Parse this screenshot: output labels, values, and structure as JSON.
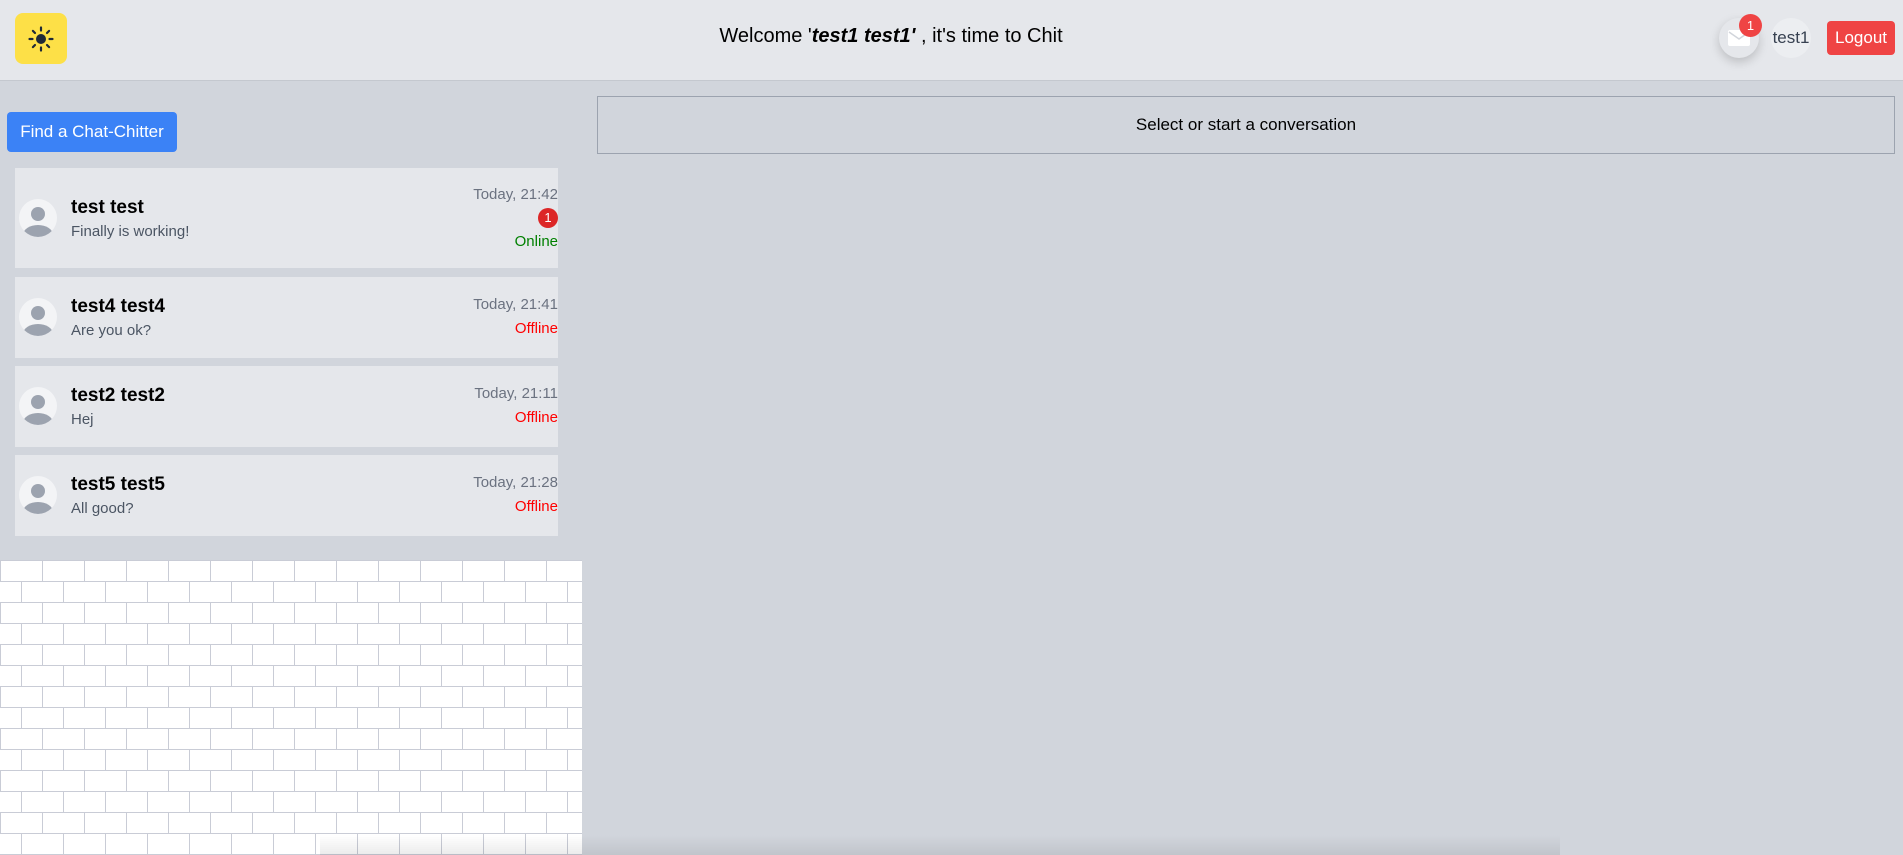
{
  "header": {
    "theme_icon": "sun-icon",
    "welcome_prefix": "Welcome '",
    "welcome_user": "test1 test1'",
    "welcome_suffix": " , it's time to Chit",
    "mail_icon": "envelope-icon",
    "mail_count": "1",
    "user_label": "test1",
    "logout_label": "Logout"
  },
  "sidebar": {
    "find_button_label": "Find a Chat-Chitter",
    "conversations": [
      {
        "name": "test test",
        "message": "Finally is working!",
        "time": "Today, 21:42",
        "unread": "1",
        "status": "Online"
      },
      {
        "name": "test4 test4",
        "message": "Are you ok?",
        "time": "Today, 21:41",
        "status": "Offline"
      },
      {
        "name": "test2 test2",
        "message": "Hej",
        "time": "Today, 21:11",
        "status": "Offline"
      },
      {
        "name": "test5 test5",
        "message": "All good?",
        "time": "Today, 21:28",
        "status": "Offline"
      }
    ]
  },
  "main": {
    "placeholder": "Select or start a conversation"
  },
  "colors": {
    "theme_button": "#fde047",
    "find_button": "#3b82f6",
    "logout_button": "#ef4444",
    "online": "#008000",
    "offline": "#ff0000"
  }
}
